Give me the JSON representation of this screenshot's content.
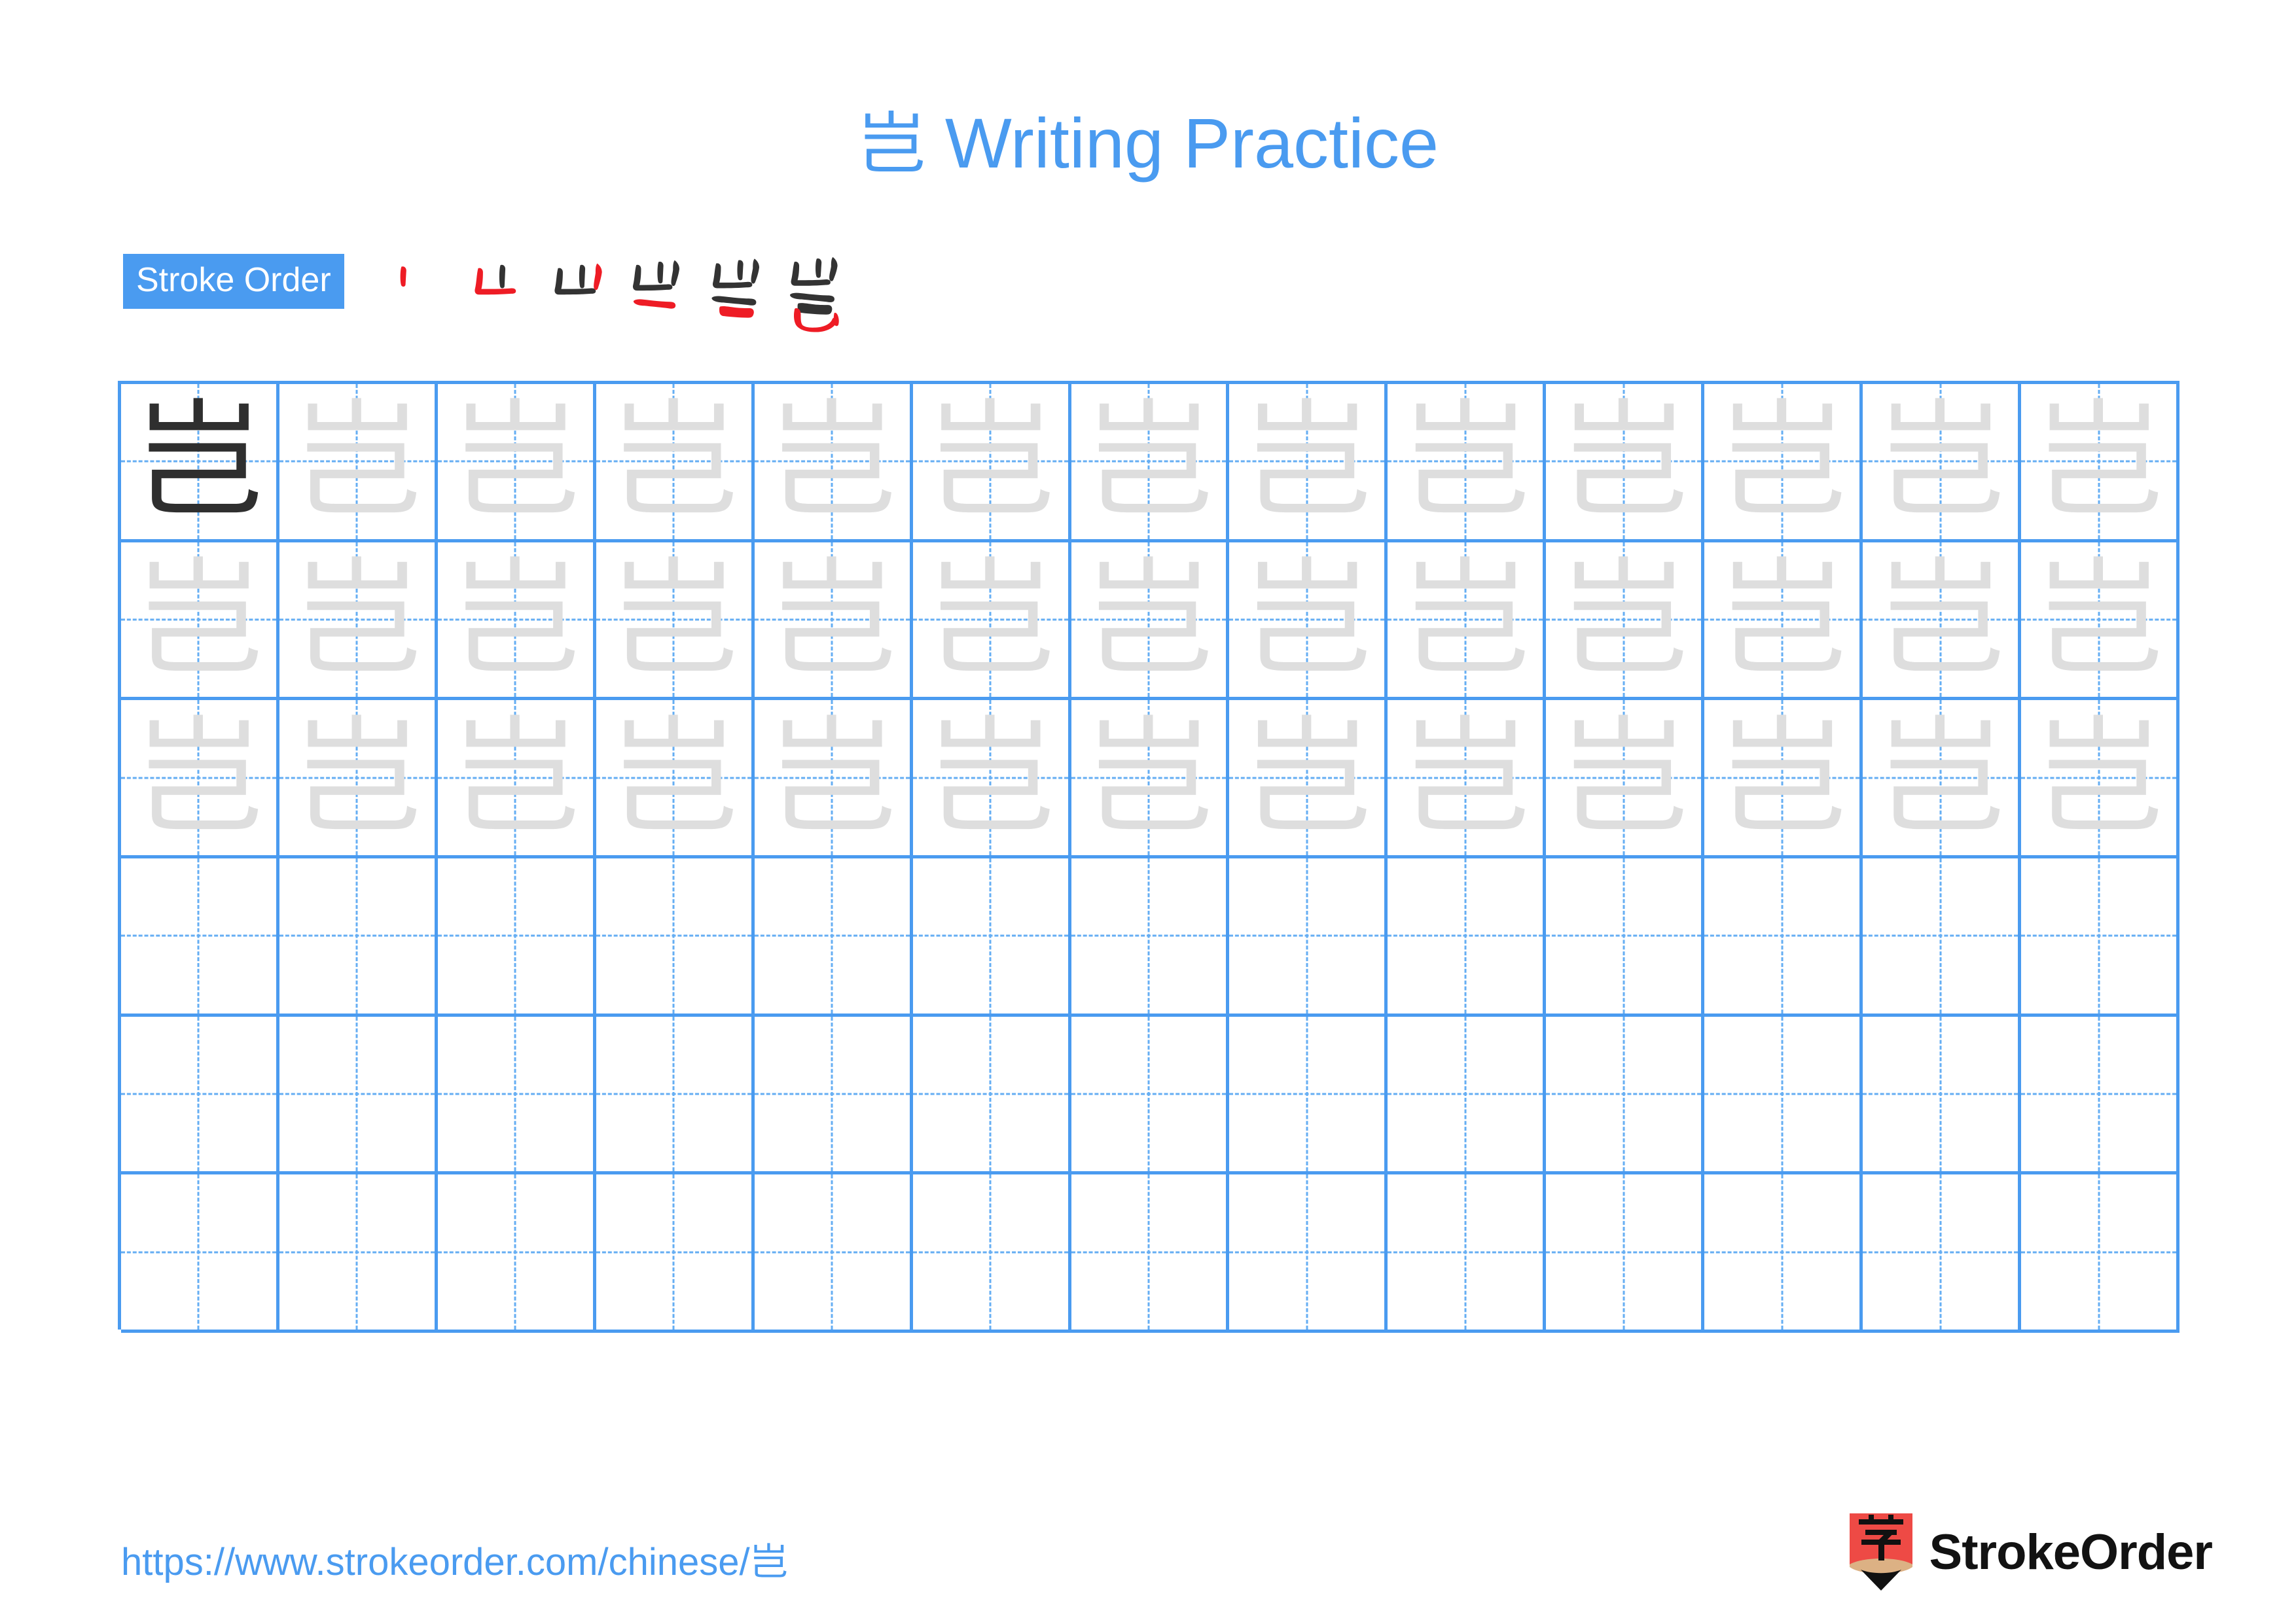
{
  "page": {
    "character": "岂",
    "background_color": "#ffffff",
    "accent_color": "#4a9bf0",
    "grid_line_color": "#4a9bf0",
    "guide_line_color": "#65aef3",
    "traced_glyph_color": "#dedede",
    "model_glyph_color": "#2f2f2f",
    "stroke_new_color": "#ee1c25",
    "stroke_old_color": "#333333"
  },
  "header": {
    "title_character": "岂",
    "title_text": " Writing Practice"
  },
  "stroke_order": {
    "badge_label": "Stroke Order",
    "stroke_count": 6,
    "steps": [
      {
        "index": 1,
        "partial": "丨"
      },
      {
        "index": 2,
        "partial": "凵"
      },
      {
        "index": 3,
        "partial": "山"
      },
      {
        "index": 4,
        "partial": "屮"
      },
      {
        "index": 5,
        "partial": "当"
      },
      {
        "index": 6,
        "partial": "岂"
      }
    ]
  },
  "practice_grid": {
    "columns": 13,
    "rows": 6,
    "rows_data": [
      {
        "row": 1,
        "cells": [
          "岂",
          "岂",
          "岂",
          "岂",
          "岂",
          "岂",
          "岂",
          "岂",
          "岂",
          "岂",
          "岂",
          "岂",
          "岂"
        ],
        "styles": [
          "dark",
          "trace",
          "trace",
          "trace",
          "trace",
          "trace",
          "trace",
          "trace",
          "trace",
          "trace",
          "trace",
          "trace",
          "trace"
        ]
      },
      {
        "row": 2,
        "cells": [
          "岂",
          "岂",
          "岂",
          "岂",
          "岂",
          "岂",
          "岂",
          "岂",
          "岂",
          "岂",
          "岂",
          "岂",
          "岂"
        ],
        "styles": [
          "trace",
          "trace",
          "trace",
          "trace",
          "trace",
          "trace",
          "trace",
          "trace",
          "trace",
          "trace",
          "trace",
          "trace",
          "trace"
        ]
      },
      {
        "row": 3,
        "cells": [
          "岂",
          "岂",
          "岂",
          "岂",
          "岂",
          "岂",
          "岂",
          "岂",
          "岂",
          "岂",
          "岂",
          "岂",
          "岂"
        ],
        "styles": [
          "trace",
          "trace",
          "trace",
          "trace",
          "trace",
          "trace",
          "trace",
          "trace",
          "trace",
          "trace",
          "trace",
          "trace",
          "trace"
        ]
      },
      {
        "row": 4,
        "cells": [
          "",
          "",
          "",
          "",
          "",
          "",
          "",
          "",
          "",
          "",
          "",
          "",
          ""
        ],
        "styles": [
          "empty",
          "empty",
          "empty",
          "empty",
          "empty",
          "empty",
          "empty",
          "empty",
          "empty",
          "empty",
          "empty",
          "empty",
          "empty"
        ]
      },
      {
        "row": 5,
        "cells": [
          "",
          "",
          "",
          "",
          "",
          "",
          "",
          "",
          "",
          "",
          "",
          "",
          ""
        ],
        "styles": [
          "empty",
          "empty",
          "empty",
          "empty",
          "empty",
          "empty",
          "empty",
          "empty",
          "empty",
          "empty",
          "empty",
          "empty",
          "empty"
        ]
      },
      {
        "row": 6,
        "cells": [
          "",
          "",
          "",
          "",
          "",
          "",
          "",
          "",
          "",
          "",
          "",
          "",
          ""
        ],
        "styles": [
          "empty",
          "empty",
          "empty",
          "empty",
          "empty",
          "empty",
          "empty",
          "empty",
          "empty",
          "empty",
          "empty",
          "empty",
          "empty"
        ]
      }
    ]
  },
  "footer": {
    "url": "https://www.strokeorder.com/chinese/岂",
    "brand_name": "StrokeOrder",
    "logo_character": "字",
    "logo_body_color": "#ee4a45",
    "logo_wood_color": "#dcb184",
    "logo_tip_color": "#111111"
  }
}
